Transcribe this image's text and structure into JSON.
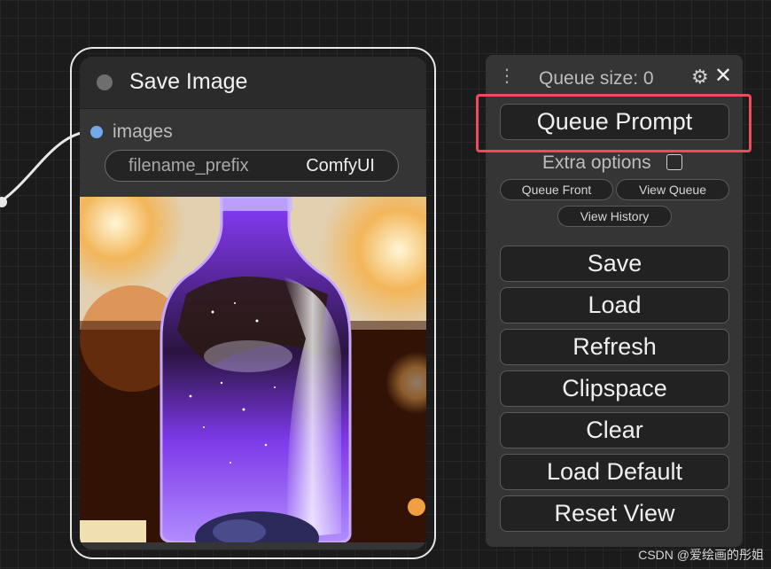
{
  "node": {
    "title": "Save Image",
    "input_label": "images",
    "widget_label": "filename_prefix",
    "widget_value": "ComfyUI"
  },
  "menu": {
    "queue_size": "Queue size: 0",
    "queue_prompt": "Queue Prompt",
    "extra_options": "Extra options",
    "queue_front": "Queue Front",
    "view_queue": "View Queue",
    "view_history": "View History",
    "save": "Save",
    "load": "Load",
    "refresh": "Refresh",
    "clipspace": "Clipspace",
    "clear": "Clear",
    "load_default": "Load Default",
    "reset_view": "Reset View",
    "drag_icon": "⋮",
    "gear_icon": "⚙",
    "close_icon": "✕"
  },
  "colors": {
    "highlight": "#ee4b5f",
    "input_dot": "#72a8ea"
  },
  "watermark": "CSDN @爱绘画的彤姐"
}
